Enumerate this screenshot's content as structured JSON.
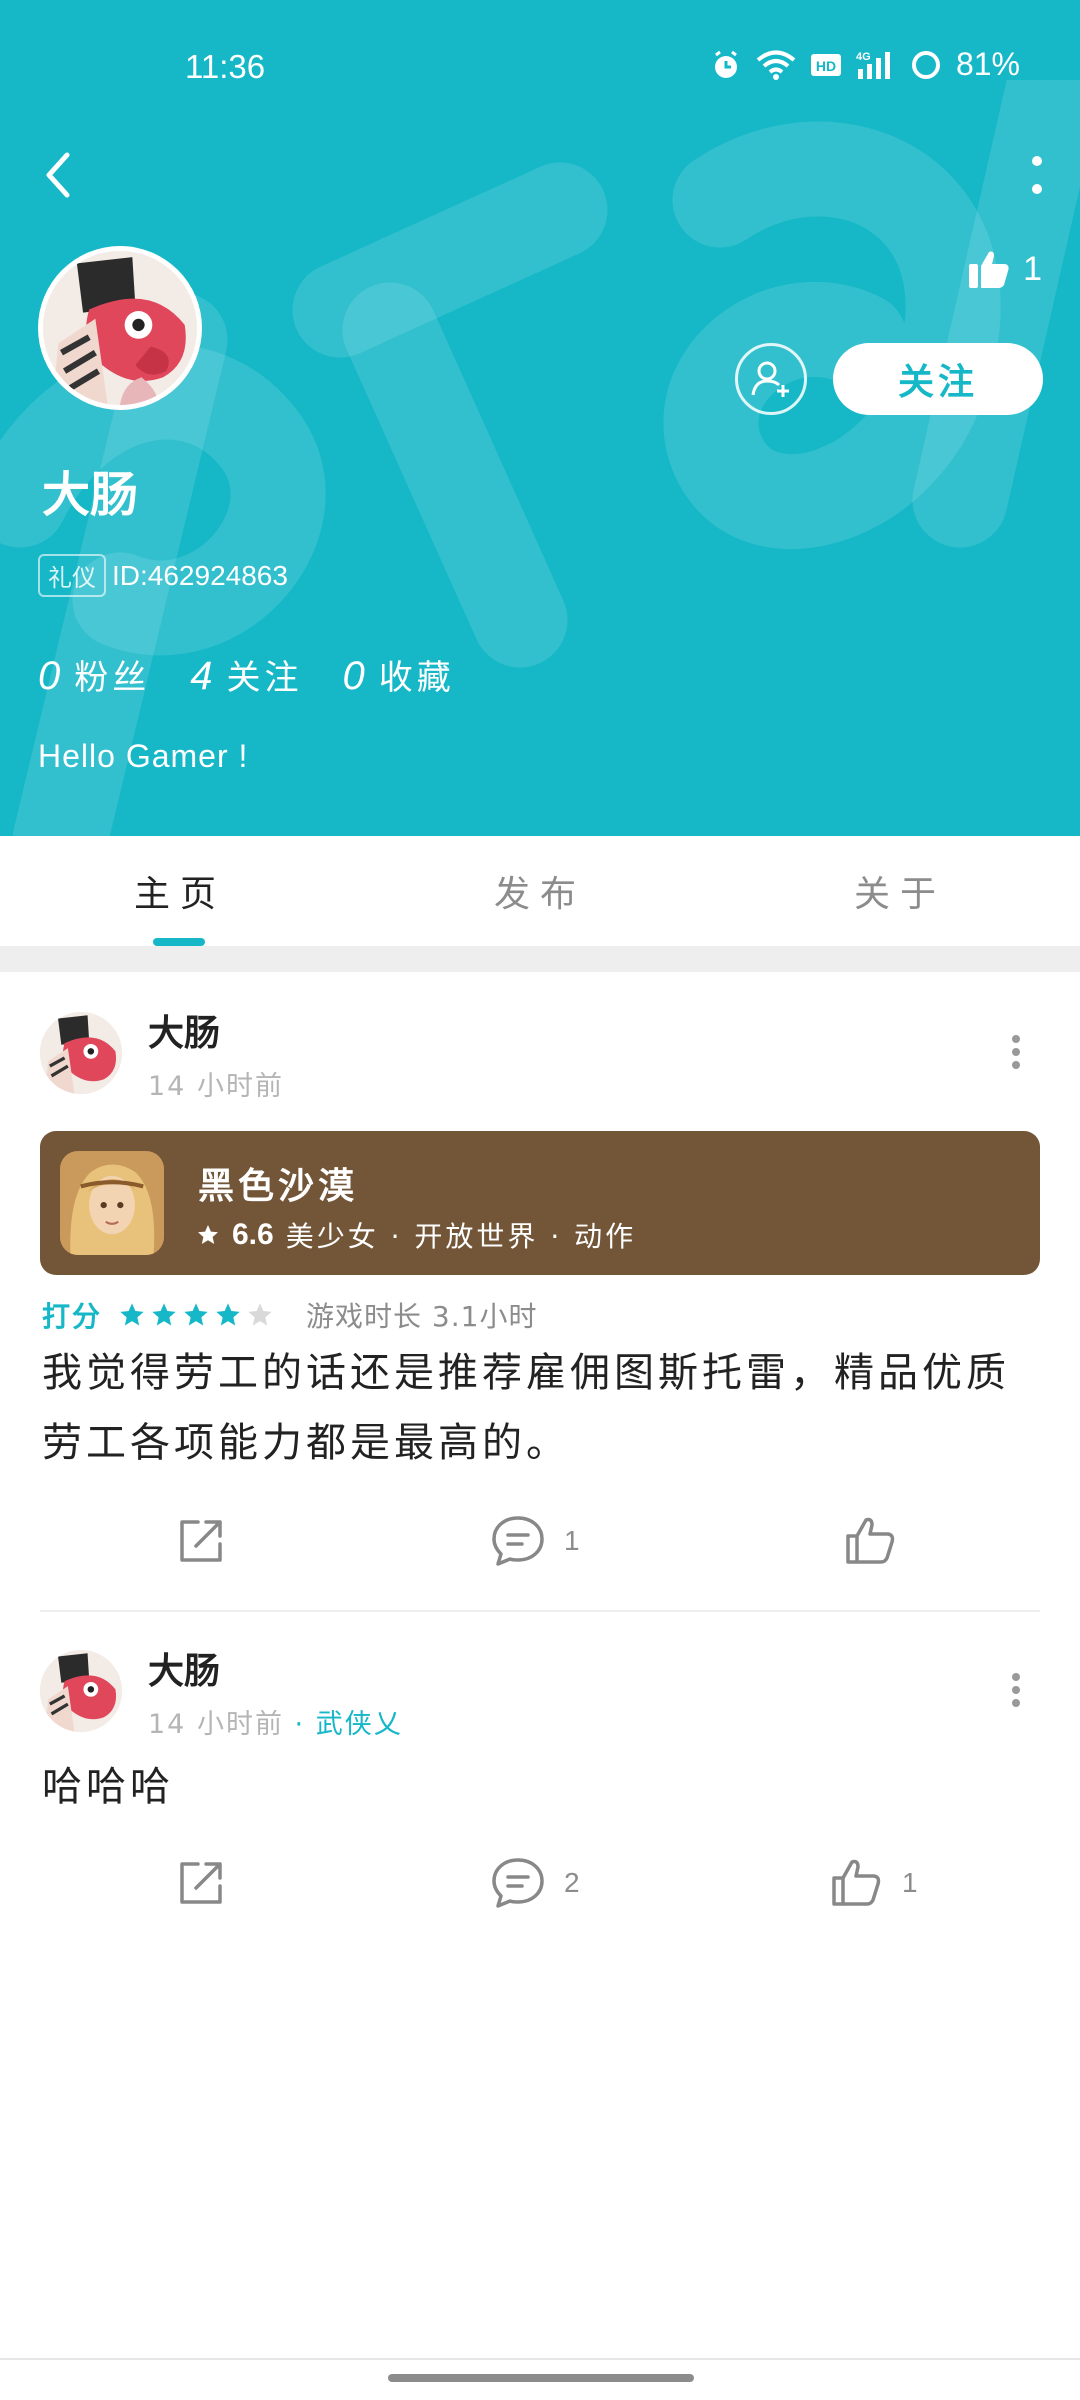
{
  "status_bar": {
    "time": "11:36",
    "battery": "81%",
    "icons": [
      "alarm-icon",
      "wifi-icon",
      "hd-icon",
      "signal-4g-icon",
      "battery-icon"
    ]
  },
  "header": {
    "background_color": "#16b8c8",
    "like_count": "1",
    "follow_label": "关注",
    "username": "大肠",
    "badge": "礼仪",
    "user_id": "ID:462924863",
    "stats": [
      {
        "num": "0",
        "label": "粉丝"
      },
      {
        "num": "4",
        "label": "关注"
      },
      {
        "num": "0",
        "label": "收藏"
      }
    ],
    "bio": "Hello Gamer !"
  },
  "tabs": [
    {
      "label": "主页",
      "active": true
    },
    {
      "label": "发布",
      "active": false
    },
    {
      "label": "关于",
      "active": false
    }
  ],
  "posts": [
    {
      "author": "大肠",
      "time": "14 小时前",
      "game": {
        "name": "黑色沙漠",
        "score": "6.6",
        "tags": "美少女 · 开放世界 · 动作",
        "card_color": "#735638"
      },
      "rating_label": "打分",
      "rating": 4,
      "rating_max": 5,
      "playtime": "游戏时长 3.1小时",
      "body": "我觉得劳工的话还是推荐雇佣图斯托雷，精品优质劳工各项能力都是最高的。",
      "comment_count": "1",
      "like_count": ""
    },
    {
      "author": "大肠",
      "time": "14 小时前",
      "circle": "· 武侠乂",
      "body": "哈哈哈",
      "comment_count": "2",
      "like_count": "1"
    }
  ],
  "colors": {
    "accent": "#16b8c8",
    "star_filled": "#16b8c8",
    "star_empty": "#d9d9d9"
  }
}
